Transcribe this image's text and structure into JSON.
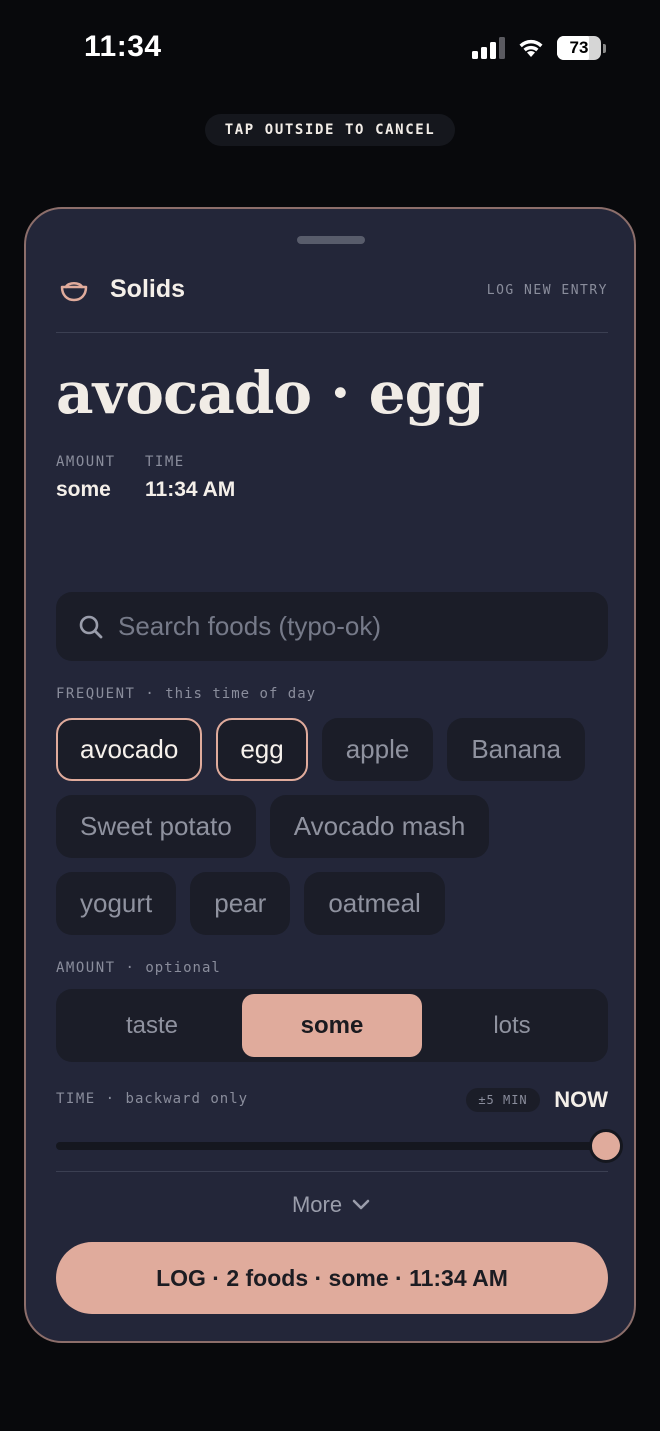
{
  "status_bar": {
    "time": "11:34",
    "battery": "73",
    "battery_level": 0.73
  },
  "cancel_hint": "TAP OUTSIDE TO CANCEL",
  "header": {
    "title": "Solids",
    "subtitle": "LOG NEW ENTRY",
    "icon": "bowl-icon"
  },
  "entry": {
    "title": "avocado · egg",
    "amount_label": "AMOUNT",
    "amount_value": "some",
    "time_label": "TIME",
    "time_value": "11:34 AM"
  },
  "search": {
    "placeholder": "Search foods (typo-ok)",
    "value": ""
  },
  "frequent": {
    "label": "FREQUENT",
    "hint": "this time of day",
    "chips": [
      {
        "label": "avocado",
        "selected": true
      },
      {
        "label": "egg",
        "selected": true
      },
      {
        "label": "apple",
        "selected": false
      },
      {
        "label": "Banana",
        "selected": false
      },
      {
        "label": "Sweet potato",
        "selected": false
      },
      {
        "label": "Avocado mash",
        "selected": false
      },
      {
        "label": "yogurt",
        "selected": false
      },
      {
        "label": "pear",
        "selected": false
      },
      {
        "label": "oatmeal",
        "selected": false
      }
    ]
  },
  "amount": {
    "label": "AMOUNT",
    "hint": "optional",
    "options": [
      "taste",
      "some",
      "lots"
    ],
    "selected": "some"
  },
  "time": {
    "label": "TIME",
    "hint": "backward only",
    "step": "±5 MIN",
    "value": "NOW",
    "slider_position": 1.0
  },
  "more_label": "More",
  "log_button": "LOG · 2 foods · some · 11:34 AM",
  "colors": {
    "accent": "#e0ab9c",
    "sheet": "#232639",
    "background": "#08090c"
  }
}
